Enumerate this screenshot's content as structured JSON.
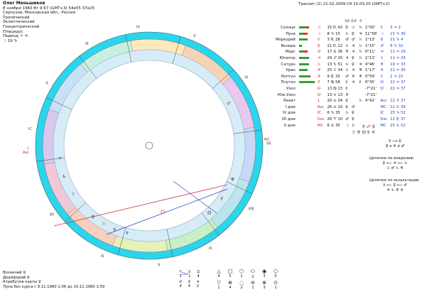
{
  "header": {
    "name": "Олег Меньшиков",
    "birth": "8 ноября 1960  Вт   9:57 (GMT+3) 54e55  37e25",
    "place": "Серпухов, Московская обл., Россия",
    "zodiac": "Тропический",
    "ecliptic": "Эклиптический",
    "geocentric": "Геоцентрический",
    "houses": "Плацидус",
    "period_label": "Период",
    "period_value": "19"
  },
  "transit": "Транзит (2) 21.02.2009  Сб 15:03:20 (GMT+2)",
  "table_header": {
    "col1": "☿♀",
    "col2": "♀♂",
    "col3": "ℬ"
  },
  "planets": [
    {
      "name": "Солнце",
      "g": 10,
      "r": 4,
      "sym": "☉",
      "pos": "15 ♏ 42",
      "a": "♀",
      "b": "☉",
      "c": "♄",
      "d": "1°00'",
      "e": "☿",
      "f": "3 ♒ 2"
    },
    {
      "name": "Луна",
      "g": 6,
      "r": 6,
      "sym": "☽",
      "pos": "8 ♑ 15",
      "a": "♄",
      "b": "♀",
      "c": "♃",
      "d": "11°56'",
      "e": "☽",
      "f": "15 ♑ 30"
    },
    {
      "name": "Меркурий",
      "g": 12,
      "r": 0,
      "sym": "☿",
      "pos": "3 ♏ 28",
      "a": "♂",
      "b": "♂",
      "c": "♄",
      "d": "1°13'",
      "e": "♀",
      "f": "21 ♑ 4"
    },
    {
      "name": "Венера",
      "g": 4,
      "r": 0,
      "sym": "♀",
      "pos": "21 ♏ 12",
      "a": "♄",
      "b": "♃",
      "c": "♄",
      "d": "1°15'",
      "e": "♂",
      "f": "8 ♑ 32"
    },
    {
      "name": "Марс",
      "g": 6,
      "r": 6,
      "sym": "♂",
      "pos": "17 ♋ 36",
      "a": "♅",
      "b": "♃",
      "c": "♄",
      "d": "0°11'",
      "e": "♃",
      "f": "11 ♒ 29"
    },
    {
      "name": "Юпитер",
      "g": 14,
      "r": 0,
      "sym": "♃",
      "pos": "29 ♐ 20",
      "a": "♃",
      "b": "♀",
      "c": "♄",
      "d": "1°13'",
      "e": "♄",
      "f": "11 ♒ 29"
    },
    {
      "name": "Сатурн",
      "g": 14,
      "r": 0,
      "sym": "♄",
      "pos": "13 ♑ 51",
      "a": "♄",
      "b": "♀",
      "c": "♃",
      "d": "4°46'",
      "e": "♅",
      "f": "19 ♒ 33"
    },
    {
      "name": "Уран",
      "g": 12,
      "r": 0,
      "sym": "♅",
      "pos": "25 ♌ 34",
      "a": "♄",
      "b": "♃",
      "c": "♅",
      "d": "1°17'",
      "e": "♆",
      "f": "21 ♒ 30"
    },
    {
      "name": "Нептун",
      "g": 14,
      "r": 2,
      "sym": "♆",
      "pos": "9 ♏ 35",
      "a": "♂",
      "b": "♆",
      "c": "♅",
      "d": "0°59'",
      "e": "♇",
      "f": "2 ♒ 22"
    },
    {
      "name": "Плутон",
      "g": 22,
      "r": 0,
      "sym": "♇",
      "pos": "7 ♍ 58",
      "a": "☿",
      "b": "♃",
      "c": "☿",
      "d": "0°35'",
      "e": "☊",
      "f": "22 ♒ 37"
    },
    {
      "name": "Узел",
      "g": 0,
      "r": 0,
      "sym": "☊",
      "pos": "13 ♍ 13",
      "a": "☿",
      "b": "",
      "c": "",
      "d": "-7°21'",
      "e": "☋",
      "f": "22 ♒ 37"
    },
    {
      "name": "Юж.Узел",
      "g": 0,
      "r": 0,
      "sym": "☋",
      "pos": "13 ♓ 13",
      "a": "♆",
      "b": "",
      "c": "",
      "d": "-7°21'",
      "e": "",
      "f": ""
    },
    {
      "name": "Лилит",
      "g": 0,
      "r": 0,
      "sym": "⚸",
      "pos": "20 ♎ 34",
      "a": "♀",
      "b": "",
      "c": "♄",
      "d": "4°42'",
      "e": "Asc",
      "f": "12 ♉ 37"
    },
    {
      "name": "I дом",
      "g": 0,
      "r": 0,
      "sym": "Asc",
      "pos": "26 ♎ 10",
      "a": "♀",
      "b": "♂",
      "c": "",
      "d": "",
      "e": "MC",
      "f": "12 ♋ 38"
    },
    {
      "name": "IV дом",
      "g": 0,
      "r": 0,
      "sym": "IC",
      "pos": "6 ♑ 35",
      "a": "♄",
      "b": "♀",
      "c": "",
      "d": "",
      "e": "IC",
      "f": "25 ♑ 52"
    },
    {
      "name": "VII дом",
      "g": 0,
      "r": 0,
      "sym": "Dsc",
      "pos": "26 ♈ 10",
      "a": "♂",
      "b": "♀",
      "c": "",
      "d": "",
      "e": "Dsc",
      "f": "12 ♏ 37"
    },
    {
      "name": "X дом",
      "g": 0,
      "r": 0,
      "sym": "MC",
      "pos": "6 ♋ 35",
      "a": "☽",
      "b": "♄",
      "c": "",
      "d": "",
      "e": "MC",
      "f": "25 ♋ 52"
    }
  ],
  "chains": {
    "top1": "☿ ⟶ ♀",
    "top2": "♀ ⚹ ♆ ☌ ♂",
    "owner_title": "Цепочки по владению",
    "owner1": "♀ ⟵ ♃ ⟵ ♄",
    "owner2": "☉ ♂ ♄ ♅",
    "exalt_title": "Цепочки по экзальтации",
    "exalt1": "☿ ⟵ ♀ ⟵ ♂",
    "exalt2": "♃ ♄ ♅ ♆"
  },
  "footer": {
    "line1_label": "Возничий",
    "line1_value": "♀",
    "line2_label": "Дорифорий",
    "line2_value": "♀",
    "line3_label": "Атрибутив карты",
    "line3_value": "♀",
    "line4": "Луна без курса с 9.11.1960  1:06 до 10.11.1960  1:59"
  },
  "bottom_icons": [
    {
      "sym": "♈",
      "n": "5"
    },
    {
      "sym": "♉",
      "n": "1"
    },
    {
      "sym": "♊",
      "n": "4"
    }
  ],
  "bottom_icons2": [
    {
      "sym": "♂",
      "n": "4"
    },
    {
      "sym": "♀",
      "n": "4"
    },
    {
      "sym": "♃",
      "n": "2"
    }
  ],
  "grid_icons": [
    "△",
    "□",
    "⬡",
    "⬭",
    "◉",
    "⬠",
    "▽",
    "⊕",
    "◌",
    "⊖",
    "⊗",
    "⊙"
  ],
  "grid_counts": [
    "4",
    "5",
    "1",
    "2",
    "3",
    "0",
    "1",
    "4",
    "2",
    "1",
    "3",
    "1"
  ],
  "chart_labels": {
    "asc": "Asc",
    "mc": "MC",
    "ic": "IC",
    "dsc": "Dsc",
    "house_labels": [
      "I",
      "II",
      "III",
      "IV",
      "V",
      "VI",
      "VII",
      "VIII",
      "IX",
      "X",
      "XI",
      "XII"
    ]
  }
}
